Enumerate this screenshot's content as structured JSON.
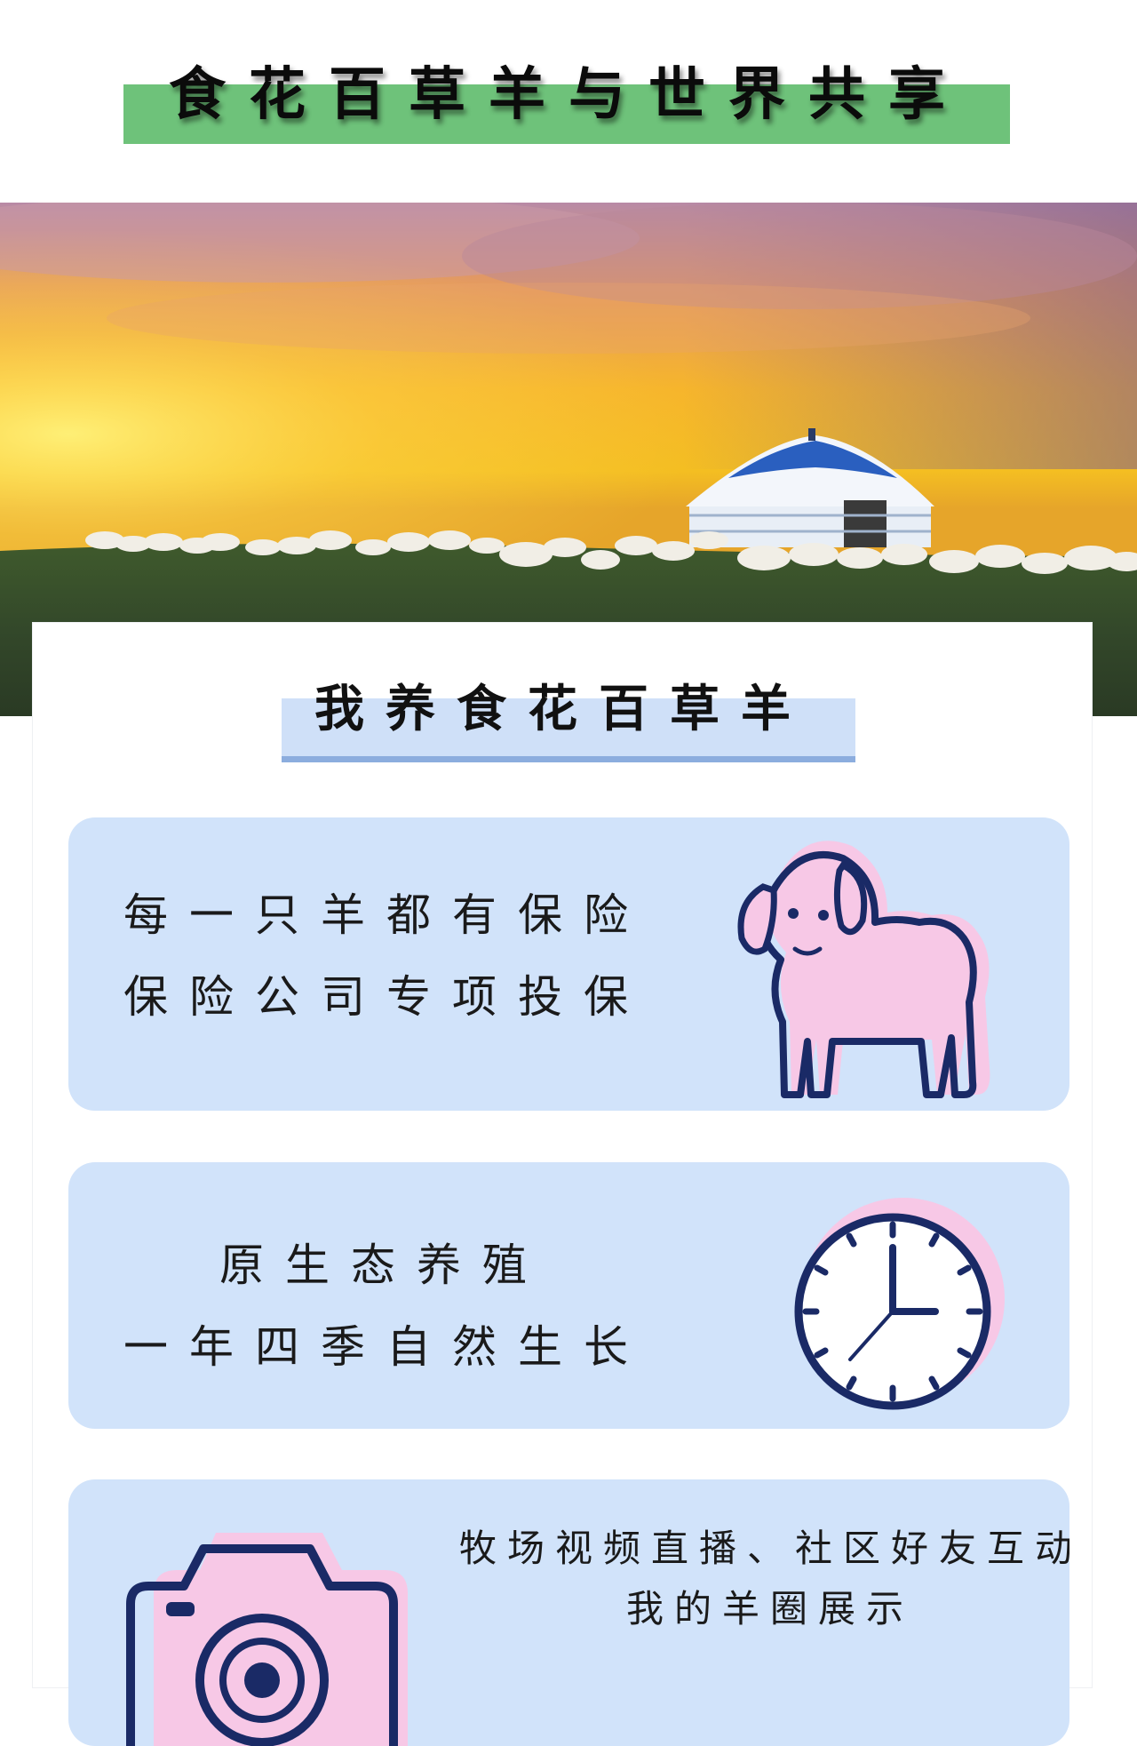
{
  "header": {
    "title": "食花百草羊与世界共享"
  },
  "section": {
    "title": "我养食花百草羊"
  },
  "features": [
    {
      "icon": "sheep-icon",
      "lines": [
        "每一只羊都有保险",
        "保险公司专项投保"
      ]
    },
    {
      "icon": "clock-icon",
      "lines": [
        "原生态养殖",
        "一年四季自然生长"
      ]
    },
    {
      "icon": "camera-icon",
      "lines": [
        "牧场视频直播、社区好友互动",
        "我的羊圈展示"
      ]
    }
  ],
  "colors": {
    "header_bar": "#6ec27a",
    "section_title_bg": "#cfe0f8",
    "section_title_underline": "#8cadde",
    "card_bg": "#d1e3fa",
    "icon_stroke": "#1a2a66",
    "icon_fill": "#f7c8e6"
  }
}
